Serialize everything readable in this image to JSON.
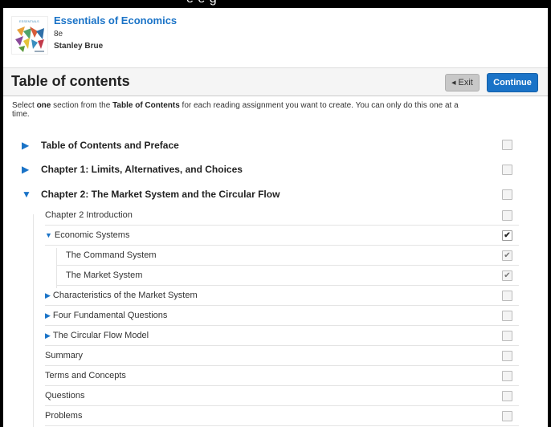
{
  "book": {
    "title": "Essentials of Economics",
    "edition": "8e",
    "author": "Stanley Brue",
    "cover_text": "ESSENTIALS"
  },
  "top_clip": "e e g",
  "header": {
    "title": "Table of contents",
    "exit_label": "Exit",
    "continue_label": "Continue"
  },
  "instructions": {
    "before": "Select ",
    "em1": "one",
    "mid": " section from the ",
    "em2": "Table of Contents",
    "after": " for each reading assignment you want to create. You can only do this one at a time."
  },
  "toc": {
    "chapters": [
      {
        "label": "Table of Contents and Preface",
        "expanded": false
      },
      {
        "label": "Chapter 1: Limits, Alternatives, and Choices",
        "expanded": false
      },
      {
        "label": "Chapter 2: The Market System and the Circular Flow",
        "expanded": true
      }
    ],
    "sections": [
      {
        "label": "Chapter 2 Introduction",
        "state": "unchecked"
      },
      {
        "label": "Economic Systems",
        "state": "checked",
        "expanded": true
      },
      {
        "label": "The Command System",
        "state": "checked-disabled"
      },
      {
        "label": "The Market System",
        "state": "checked-disabled"
      },
      {
        "label": "Characteristics of the Market System",
        "state": "unchecked",
        "expanded": false
      },
      {
        "label": "Four Fundamental Questions",
        "state": "unchecked",
        "expanded": false
      },
      {
        "label": "The Circular Flow Model",
        "state": "unchecked",
        "expanded": false
      },
      {
        "label": "Summary",
        "state": "unchecked"
      },
      {
        "label": "Terms and Concepts",
        "state": "unchecked"
      },
      {
        "label": "Questions",
        "state": "unchecked"
      },
      {
        "label": "Problems",
        "state": "unchecked"
      }
    ]
  },
  "colors": {
    "accent": "#1a73c7",
    "exit_button": "#c8c8c8"
  }
}
